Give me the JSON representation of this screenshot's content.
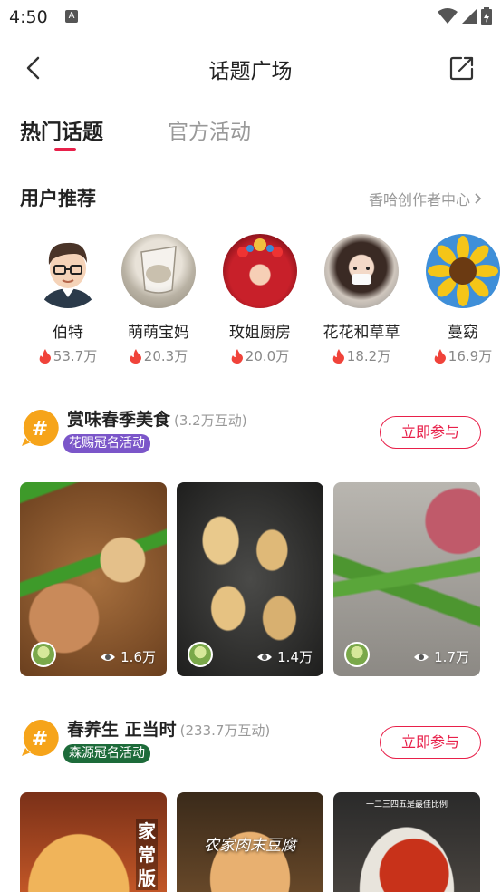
{
  "status": {
    "time": "4:50",
    "app_letter": "A"
  },
  "nav": {
    "title": "话题广场"
  },
  "tabs": [
    {
      "label": "热门话题",
      "active": true
    },
    {
      "label": "官方活动",
      "active": false
    }
  ],
  "recommend": {
    "title": "用户推荐",
    "creator_link": "香哈创作者中心"
  },
  "users": [
    {
      "name": "伯特",
      "score": "53.7万",
      "avatar": "cartoon-man-with-glasses"
    },
    {
      "name": "萌萌宝妈",
      "score": "20.3万",
      "avatar": "glass-cup-photo"
    },
    {
      "name": "玫姐厨房",
      "score": "20.0万",
      "avatar": "opera-costume-photo"
    },
    {
      "name": "花花和草草",
      "score": "18.2万",
      "avatar": "child-with-mask-photo"
    },
    {
      "name": "蔓窈",
      "score": "16.9万",
      "avatar": "sunflower-photo"
    }
  ],
  "topics": [
    {
      "title": "赏味春季美食",
      "count": "(3.2万互动)",
      "tag": "花赐冠名活动",
      "tag_color": "#7b56c9",
      "join_label": "立即参与",
      "posts": [
        {
          "views": "1.6万",
          "image": "braised-chicken-with-peppers"
        },
        {
          "views": "1.4万",
          "image": "pan-fried-tofu"
        },
        {
          "views": "1.7万",
          "image": "hand-holding-wild-garlic"
        }
      ]
    },
    {
      "title": "春养生 正当时",
      "count": "(233.7万互动)",
      "tag": "森源冠名活动",
      "tag_color": "#1d6b3a",
      "join_label": "立即参与",
      "posts": [
        {
          "overlay": "家常版",
          "image": "pancake"
        },
        {
          "overlay": "农家肉末豆腐",
          "image": "minced-pork-tofu"
        },
        {
          "overlay": "一二三四五是最佳比例",
          "image": "chili-sauce-spoon"
        }
      ]
    }
  ]
}
